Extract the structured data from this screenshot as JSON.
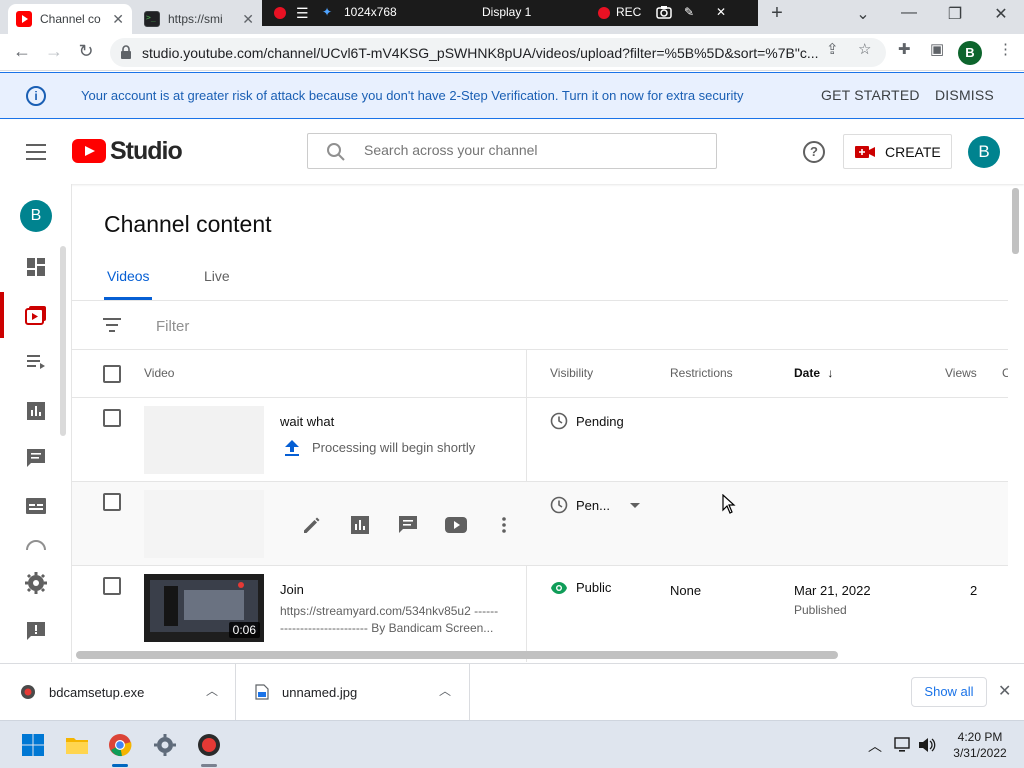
{
  "browser": {
    "tabs": [
      {
        "title": "Channel co",
        "active": true
      },
      {
        "title": "https://smi",
        "active": false
      }
    ],
    "url": "studio.youtube.com/channel/UCvl6T-mV4KSG_pSWHNK8pUA/videos/upload?filter=%5B%5D&sort=%7B\"c...",
    "profile_initial": "B"
  },
  "recorder": {
    "resolution": "1024x768",
    "display": "Display 1",
    "rec_label": "REC"
  },
  "banner": {
    "message": "Your account is at greater risk of attack because you don't have 2-Step Verification. Turn it on now for extra security",
    "get_started": "GET STARTED",
    "dismiss": "DISMISS"
  },
  "header": {
    "logo_text": "Studio",
    "search_placeholder": "Search across your channel",
    "create_label": "CREATE",
    "avatar_initial": "B"
  },
  "nav": {
    "avatar_initial": "B",
    "items": [
      "dashboard-icon",
      "content-icon",
      "playlists-icon",
      "analytics-icon",
      "comments-icon",
      "subtitles-icon",
      "settings-icon",
      "feedback-icon"
    ],
    "active": "content-icon"
  },
  "content": {
    "page_title": "Channel content",
    "tabs": [
      "Videos",
      "Live"
    ],
    "active_tab": "Videos",
    "filter_label": "Filter",
    "columns": {
      "video": "Video",
      "visibility": "Visibility",
      "restrictions": "Restrictions",
      "date": "Date",
      "views": "Views",
      "comments": "C"
    },
    "rows": [
      {
        "title": "wait what",
        "status": "Processing will begin shortly",
        "visibility": "Pending"
      },
      {
        "title": "",
        "visibility": "Pen..."
      },
      {
        "title": "Join",
        "description_line1": "https://streamyard.com/534nkv85u2 ------",
        "description_line2": "---------------------- By Bandicam Screen...",
        "duration": "0:06",
        "visibility": "Public",
        "restrictions": "None",
        "date": "Mar 21, 2022",
        "date_status": "Published",
        "views": "2"
      }
    ]
  },
  "downloads": {
    "items": [
      "bdcamsetup.exe",
      "unnamed.jpg"
    ],
    "show_all": "Show all"
  },
  "taskbar": {
    "time": "4:20 PM",
    "date": "3/31/2022"
  },
  "colors": {
    "accent_blue": "#065fd4",
    "yt_red": "#ff0000",
    "public_green": "#0f9d58",
    "banner_bg": "#e8f0fe"
  }
}
